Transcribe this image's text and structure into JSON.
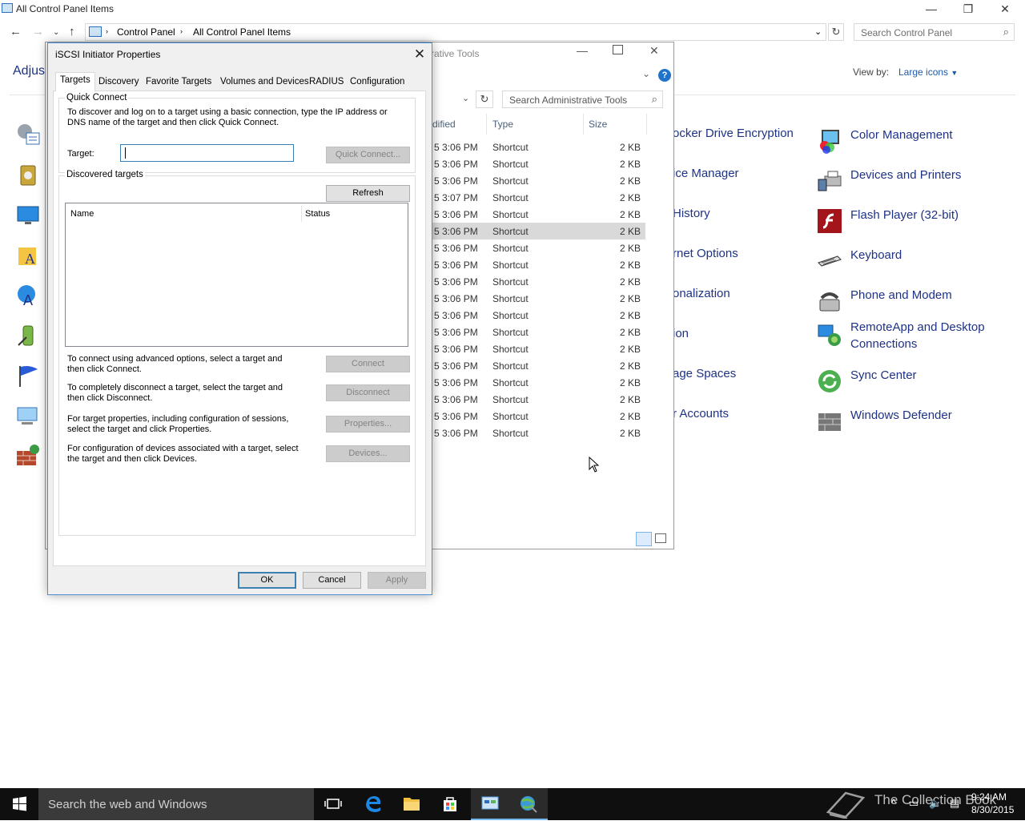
{
  "control_panel": {
    "window_title": "All Control Panel Items",
    "caption_buttons": {
      "minimize": "—",
      "restore": "❐",
      "close": "✕"
    },
    "breadcrumbs": [
      "Control Panel",
      "All Control Panel Items"
    ],
    "search_placeholder": "Search Control Panel",
    "heading_partial": "Adjus",
    "view_by_label": "View by:",
    "view_by_value": "Large icons",
    "partial_items": [
      "ocker Drive Encryption",
      "ice Manager",
      "History",
      "rnet Options",
      "onalization",
      "ion",
      "age Spaces",
      "r Accounts"
    ],
    "items": [
      {
        "label": "Color Management",
        "icon": "color-management-icon"
      },
      {
        "label": "Devices and Printers",
        "icon": "devices-printers-icon"
      },
      {
        "label": "Flash Player (32-bit)",
        "icon": "flash-player-icon"
      },
      {
        "label": "Keyboard",
        "icon": "keyboard-icon"
      },
      {
        "label": "Phone and Modem",
        "icon": "phone-modem-icon"
      },
      {
        "label": "RemoteApp and Desktop Connections",
        "label_line1": "RemoteApp and Desktop",
        "label_line2": "Connections",
        "icon": "remoteapp-icon"
      },
      {
        "label": "Sync Center",
        "icon": "sync-center-icon"
      },
      {
        "label": "Windows Defender",
        "icon": "windows-defender-icon"
      }
    ]
  },
  "admin_tools": {
    "title_partial": "rative Tools",
    "search_placeholder": "Search Administrative Tools",
    "columns": {
      "modified_partial": "dified",
      "type": "Type",
      "size": "Size"
    },
    "rows": [
      {
        "modified": "5 3:06 PM",
        "type": "Shortcut",
        "size": "2 KB"
      },
      {
        "modified": "5 3:06 PM",
        "type": "Shortcut",
        "size": "2 KB"
      },
      {
        "modified": "5 3:06 PM",
        "type": "Shortcut",
        "size": "2 KB"
      },
      {
        "modified": "5 3:07 PM",
        "type": "Shortcut",
        "size": "2 KB"
      },
      {
        "modified": "5 3:06 PM",
        "type": "Shortcut",
        "size": "2 KB"
      },
      {
        "modified": "5 3:06 PM",
        "type": "Shortcut",
        "size": "2 KB",
        "selected": true
      },
      {
        "modified": "5 3:06 PM",
        "type": "Shortcut",
        "size": "2 KB"
      },
      {
        "modified": "5 3:06 PM",
        "type": "Shortcut",
        "size": "2 KB"
      },
      {
        "modified": "5 3:06 PM",
        "type": "Shortcut",
        "size": "2 KB"
      },
      {
        "modified": "5 3:06 PM",
        "type": "Shortcut",
        "size": "2 KB"
      },
      {
        "modified": "5 3:06 PM",
        "type": "Shortcut",
        "size": "2 KB"
      },
      {
        "modified": "5 3:06 PM",
        "type": "Shortcut",
        "size": "2 KB"
      },
      {
        "modified": "5 3:06 PM",
        "type": "Shortcut",
        "size": "2 KB"
      },
      {
        "modified": "5 3:06 PM",
        "type": "Shortcut",
        "size": "2 KB"
      },
      {
        "modified": "5 3:06 PM",
        "type": "Shortcut",
        "size": "2 KB"
      },
      {
        "modified": "5 3:06 PM",
        "type": "Shortcut",
        "size": "2 KB"
      },
      {
        "modified": "5 3:06 PM",
        "type": "Shortcut",
        "size": "2 KB"
      },
      {
        "modified": "5 3:06 PM",
        "type": "Shortcut",
        "size": "2 KB"
      }
    ]
  },
  "dialog": {
    "title": "iSCSI Initiator Properties",
    "tabs": [
      "Targets",
      "Discovery",
      "Favorite Targets",
      "Volumes and Devices",
      "RADIUS",
      "Configuration"
    ],
    "quick_connect": {
      "group_title": "Quick Connect",
      "description": "To discover and log on to a target using a basic connection, type the IP address or DNS name of the target and then click Quick Connect.",
      "target_label": "Target:",
      "target_value": "",
      "button": "Quick Connect..."
    },
    "discovered": {
      "group_title": "Discovered targets",
      "refresh_button": "Refresh",
      "columns": [
        "Name",
        "Status"
      ]
    },
    "actions": [
      {
        "text": "To connect using advanced options, select a target and then click Connect.",
        "button": "Connect"
      },
      {
        "text": "To completely disconnect a target, select the target and then click Disconnect.",
        "button": "Disconnect"
      },
      {
        "text": "For target properties, including configuration of sessions, select the target and click Properties.",
        "button": "Properties..."
      },
      {
        "text": "For configuration of devices associated with a target, select the target and then click Devices.",
        "button": "Devices..."
      }
    ],
    "ok": "OK",
    "cancel": "Cancel",
    "apply": "Apply"
  },
  "taskbar": {
    "search_placeholder": "Search the web and Windows",
    "time": "9:24 AM",
    "date": "8/30/2015",
    "watermark": "The Collection Book"
  },
  "colors": {
    "accent": "#1e3287",
    "selection": "#d9d9d9",
    "focus": "#3c7fb1"
  }
}
